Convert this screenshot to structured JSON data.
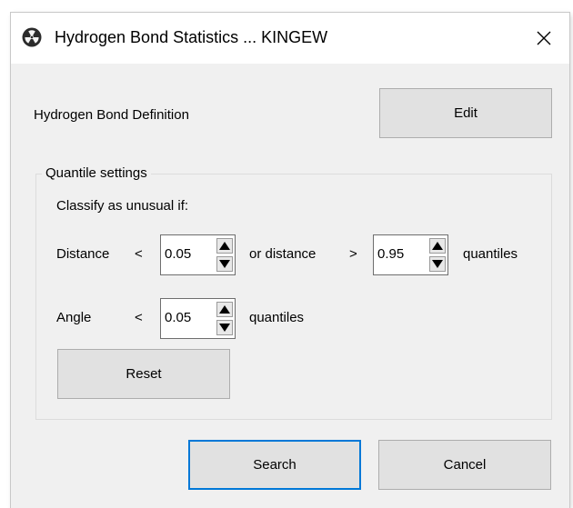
{
  "window": {
    "title": "Hydrogen Bond Statistics ... KINGEW"
  },
  "definition": {
    "label": "Hydrogen Bond Definition",
    "edit_label": "Edit"
  },
  "quantile": {
    "group_title": "Quantile settings",
    "classify_label": "Classify as unusual if:",
    "distance_label": "Distance",
    "lt_symbol": "<",
    "distance_low": "0.05",
    "or_distance_label": "or distance",
    "gt_symbol": ">",
    "distance_high": "0.95",
    "quantiles_label": "quantiles",
    "angle_label": "Angle",
    "angle_lt_symbol": "<",
    "angle_low": "0.05",
    "angle_quantiles_label": "quantiles",
    "reset_label": "Reset"
  },
  "footer": {
    "search_label": "Search",
    "cancel_label": "Cancel"
  },
  "icons": {
    "app": "radiation-icon",
    "close": "close-icon",
    "up": "spin-up-icon",
    "down": "spin-down-icon"
  }
}
